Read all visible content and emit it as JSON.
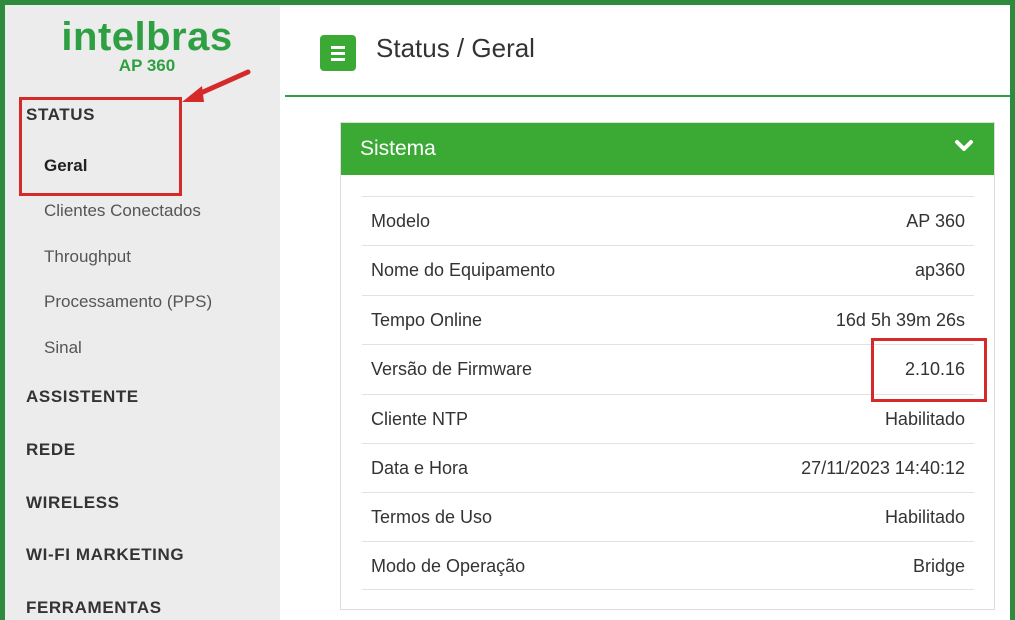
{
  "brand": {
    "logo_text": "intelbras",
    "model": "AP 360",
    "color": "#2ea043"
  },
  "sidebar": {
    "sections": [
      {
        "label": "STATUS",
        "items": [
          {
            "label": "Geral",
            "active": true
          },
          {
            "label": "Clientes Conectados",
            "active": false
          },
          {
            "label": "Throughput",
            "active": false
          },
          {
            "label": "Processamento (PPS)",
            "active": false
          },
          {
            "label": "Sinal",
            "active": false
          }
        ]
      },
      {
        "label": "ASSISTENTE"
      },
      {
        "label": "REDE"
      },
      {
        "label": "WIRELESS"
      },
      {
        "label": "WI-FI MARKETING"
      },
      {
        "label": "FERRAMENTAS"
      }
    ]
  },
  "header": {
    "menu_icon": "hamburger-menu-icon",
    "title": "Status / Geral"
  },
  "panel": {
    "title": "Sistema",
    "toggle_icon": "chevron-down-icon",
    "rows": [
      {
        "label": "Modelo",
        "value": "AP 360"
      },
      {
        "label": "Nome do Equipamento",
        "value": "ap360"
      },
      {
        "label": "Tempo Online",
        "value": "16d 5h 39m 26s"
      },
      {
        "label": "Versão de Firmware",
        "value": "2.10.16"
      },
      {
        "label": "Cliente NTP",
        "value": "Habilitado"
      },
      {
        "label": "Data e Hora",
        "value": "27/11/2023 14:40:12"
      },
      {
        "label": "Termos de Uso",
        "value": "Habilitado"
      },
      {
        "label": "Modo de Operação",
        "value": "Bridge"
      }
    ]
  },
  "colors": {
    "accent_green": "#3aaa35",
    "frame_green": "#2e8b3e",
    "annotation_red": "#d42a2a"
  }
}
